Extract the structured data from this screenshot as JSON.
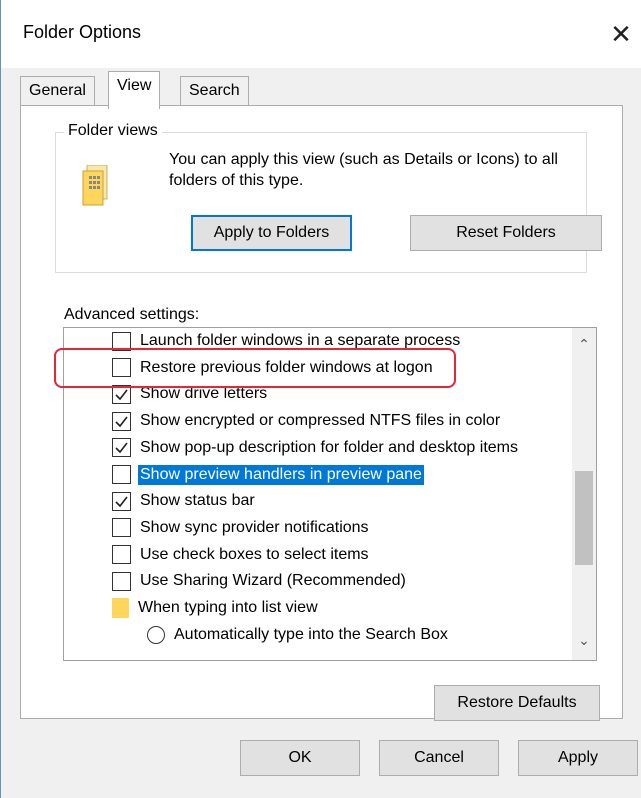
{
  "window": {
    "title": "Folder Options",
    "close_symbol": "✕"
  },
  "tabs": [
    {
      "label": "General"
    },
    {
      "label": "View"
    },
    {
      "label": "Search"
    }
  ],
  "folder_views": {
    "legend": "Folder views",
    "description": "You can apply this view (such as Details or Icons) to all folders of this type.",
    "apply_button": "Apply to Folders",
    "reset_button": "Reset Folders"
  },
  "advanced": {
    "label": "Advanced settings:",
    "items": [
      {
        "type": "checkbox",
        "checked": false,
        "label": "Launch folder windows in a separate process"
      },
      {
        "type": "checkbox",
        "checked": false,
        "label": "Restore previous folder windows at logon"
      },
      {
        "type": "checkbox",
        "checked": true,
        "label": "Show drive letters"
      },
      {
        "type": "checkbox",
        "checked": true,
        "label": "Show encrypted or compressed NTFS files in color"
      },
      {
        "type": "checkbox",
        "checked": true,
        "label": "Show pop-up description for folder and desktop items"
      },
      {
        "type": "checkbox",
        "checked": false,
        "label": "Show preview handlers in preview pane",
        "selected": true
      },
      {
        "type": "checkbox",
        "checked": true,
        "label": "Show status bar"
      },
      {
        "type": "checkbox",
        "checked": false,
        "label": "Show sync provider notifications"
      },
      {
        "type": "checkbox",
        "checked": false,
        "label": "Use check boxes to select items"
      },
      {
        "type": "checkbox",
        "checked": false,
        "label": "Use Sharing Wizard (Recommended)"
      },
      {
        "type": "folder",
        "label": "When typing into list view"
      },
      {
        "type": "radio",
        "checked": false,
        "label": "Automatically type into the Search Box"
      }
    ],
    "scroll_up": "⌃",
    "scroll_down": "⌄"
  },
  "restore_defaults_button": "Restore Defaults",
  "footer": {
    "ok": "OK",
    "cancel": "Cancel",
    "apply": "Apply"
  },
  "colors": {
    "accent": "#0078d7",
    "highlight_ring": "#e3263b",
    "folder": "#ffd65c"
  }
}
